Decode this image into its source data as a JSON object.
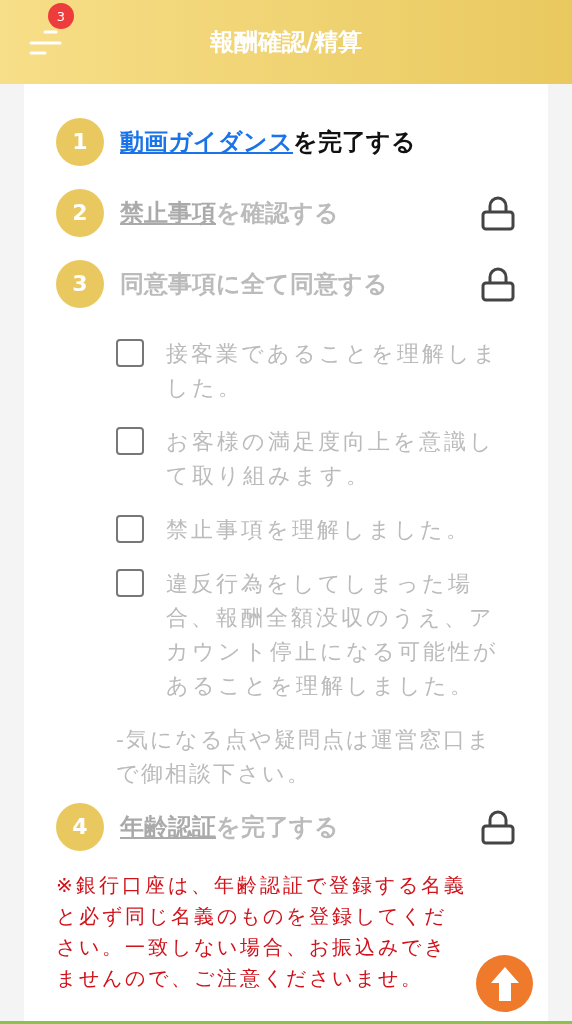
{
  "header": {
    "title": "報酬確認/精算",
    "menu_badge": "3"
  },
  "steps": [
    {
      "number": "1",
      "link": "動画ガイダンス",
      "text": "を完了する",
      "locked": false
    },
    {
      "number": "2",
      "link": "禁止事項",
      "text": "を確認する",
      "locked": true
    },
    {
      "number": "3",
      "text": "同意事項に全て同意する",
      "locked": true,
      "agreements": [
        {
          "label": "接客業であることを理解しました。",
          "checked": false
        },
        {
          "label": "お客様の満足度向上を意識して取り組みます。",
          "checked": false
        },
        {
          "label": "禁止事項を理解しました。",
          "checked": false
        },
        {
          "label": "違反行為をしてしまった場合、報酬全額没収のうえ、アカウント停止になる可能性があることを理解しました。",
          "checked": false
        }
      ],
      "note": "-気になる点や疑問点は運営窓口まで御相談下さい。"
    },
    {
      "number": "4",
      "link": "年齢認証",
      "text": "を完了する",
      "locked": true
    }
  ],
  "warning": "※銀行口座は、年齢認証で登録する名義と必ず同じ名義のものを登録してください。一致しない場合、お振込みできませんので、ご注意くださいませ。"
}
